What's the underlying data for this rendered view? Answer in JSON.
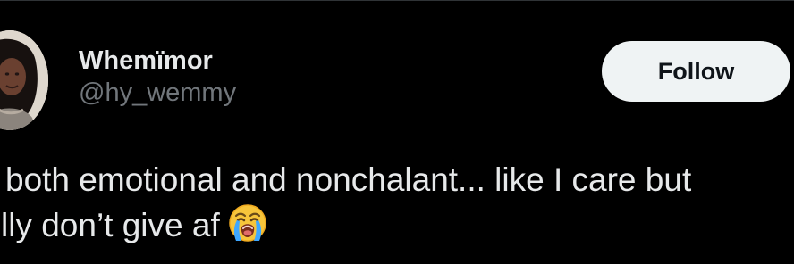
{
  "theme": {
    "background": "#000000",
    "text_primary": "#e7e9ea",
    "text_secondary": "#71767b",
    "follow_button_bg": "#eff3f4",
    "follow_button_text": "#0f1419"
  },
  "author": {
    "display_name": "Whemïmor",
    "handle": "@hy_wemmy",
    "avatar_icon": "profile-photo"
  },
  "actions": {
    "follow_label": "Follow"
  },
  "tweet": {
    "line_1": "both emotional and nonchalant... like I care but",
    "line_2": "lly don’t give af",
    "emoji_icon": "loudly-crying-face-emoji"
  }
}
